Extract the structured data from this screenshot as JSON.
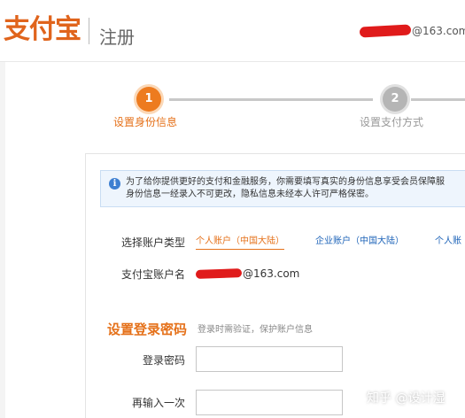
{
  "header": {
    "logo_text": "支付宝",
    "title": "注册",
    "account_domain": "@163.com"
  },
  "steps": [
    {
      "number": "1",
      "label": "设置身份信息",
      "state": "active"
    },
    {
      "number": "2",
      "label": "设置支付方式",
      "state": "inactive"
    }
  ],
  "notice": {
    "icon": "info-icon",
    "line1": "为了给你提供更好的支付和金融服务，你需要填写真实的身份信息享受会员保障服",
    "line2": "身份信息一经录入不可更改，隐私信息未经本人许可严格保密。"
  },
  "form": {
    "account_type_label": "选择账户类型",
    "account_types": [
      {
        "label": "个人账户（中国大陆）",
        "selected": true
      },
      {
        "label": "企业账户（中国大陆）",
        "selected": false
      },
      {
        "label": "个人账",
        "selected": false
      }
    ],
    "account_name_label": "支付宝账户名",
    "account_name_domain": "@163.com",
    "password_section_title": "设置登录密码",
    "password_section_hint": "登录时需验证，保护账户信息",
    "login_password_label": "登录密码",
    "login_password_value": "",
    "confirm_password_label": "再输入一次",
    "confirm_password_value": ""
  },
  "watermark": "知乎 @设计湿",
  "colors": {
    "brand_orange": "#e5711a",
    "link_blue": "#1d63b8",
    "redaction_red": "#e01b1b"
  }
}
